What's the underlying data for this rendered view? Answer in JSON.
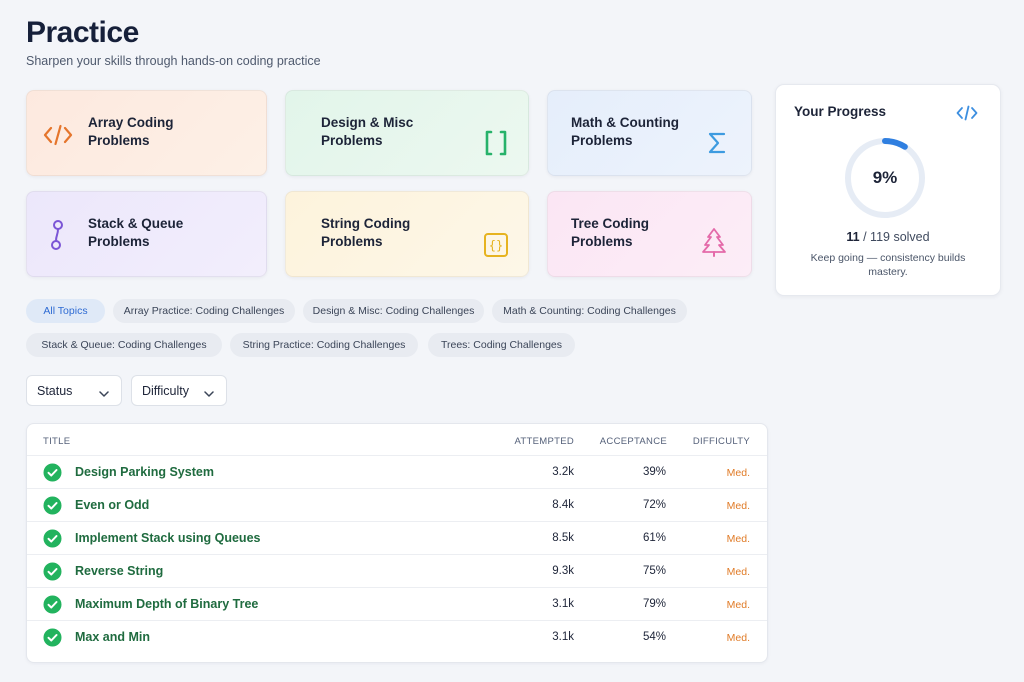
{
  "header": {
    "title": "Practice",
    "subtitle": "Sharpen your skills through hands-on coding practice"
  },
  "categories": [
    {
      "id": "array",
      "line1": "Array Coding",
      "line2": "Problems",
      "icon": "code-brackets-icon"
    },
    {
      "id": "design",
      "line1": "Design & Misc",
      "line2": "Problems",
      "icon": "square-brackets-icon"
    },
    {
      "id": "math",
      "line1": "Math & Counting",
      "line2": "Problems",
      "icon": "sigma-icon"
    },
    {
      "id": "stack",
      "line1": "Stack & Queue",
      "line2": "Problems",
      "icon": "nodes-icon"
    },
    {
      "id": "string",
      "line1": "String Coding",
      "line2": "Problems",
      "icon": "curly-braces-icon"
    },
    {
      "id": "tree",
      "line1": "Tree Coding",
      "line2": "Problems",
      "icon": "tree-icon"
    }
  ],
  "progress": {
    "title": "Your Progress",
    "percent_label": "9%",
    "percent": 9,
    "solved": "11",
    "total_label": "/ 119 solved",
    "note": "Keep going — consistency builds mastery."
  },
  "topics": [
    "All Topics",
    "Array Practice: Coding Challenges",
    "Design & Misc: Coding Challenges",
    "Math & Counting: Coding Challenges",
    "Stack & Queue: Coding Challenges",
    "String Practice: Coding Challenges",
    "Trees: Coding Challenges"
  ],
  "filters": {
    "status": "Status",
    "difficulty": "Difficulty"
  },
  "table": {
    "headers": {
      "title": "TITLE",
      "attempted": "ATTEMPTED",
      "acceptance": "ACCEPTANCE",
      "difficulty": "DIFFICULTY"
    },
    "rows": [
      {
        "title": "Design Parking System",
        "attempted": "3.2k",
        "acceptance": "39%",
        "difficulty": "Med."
      },
      {
        "title": "Even or Odd",
        "attempted": "8.4k",
        "acceptance": "72%",
        "difficulty": "Med."
      },
      {
        "title": "Implement Stack using Queues",
        "attempted": "8.5k",
        "acceptance": "61%",
        "difficulty": "Med."
      },
      {
        "title": "Reverse String",
        "attempted": "9.3k",
        "acceptance": "75%",
        "difficulty": "Med."
      },
      {
        "title": "Maximum Depth of Binary Tree",
        "attempted": "3.1k",
        "acceptance": "79%",
        "difficulty": "Med."
      },
      {
        "title": "Max and Min",
        "attempted": "3.1k",
        "acceptance": "54%",
        "difficulty": "Med."
      }
    ]
  },
  "colors": {
    "accent": "#2e6bd3",
    "success": "#22b35e",
    "medium": "#e07b27"
  }
}
